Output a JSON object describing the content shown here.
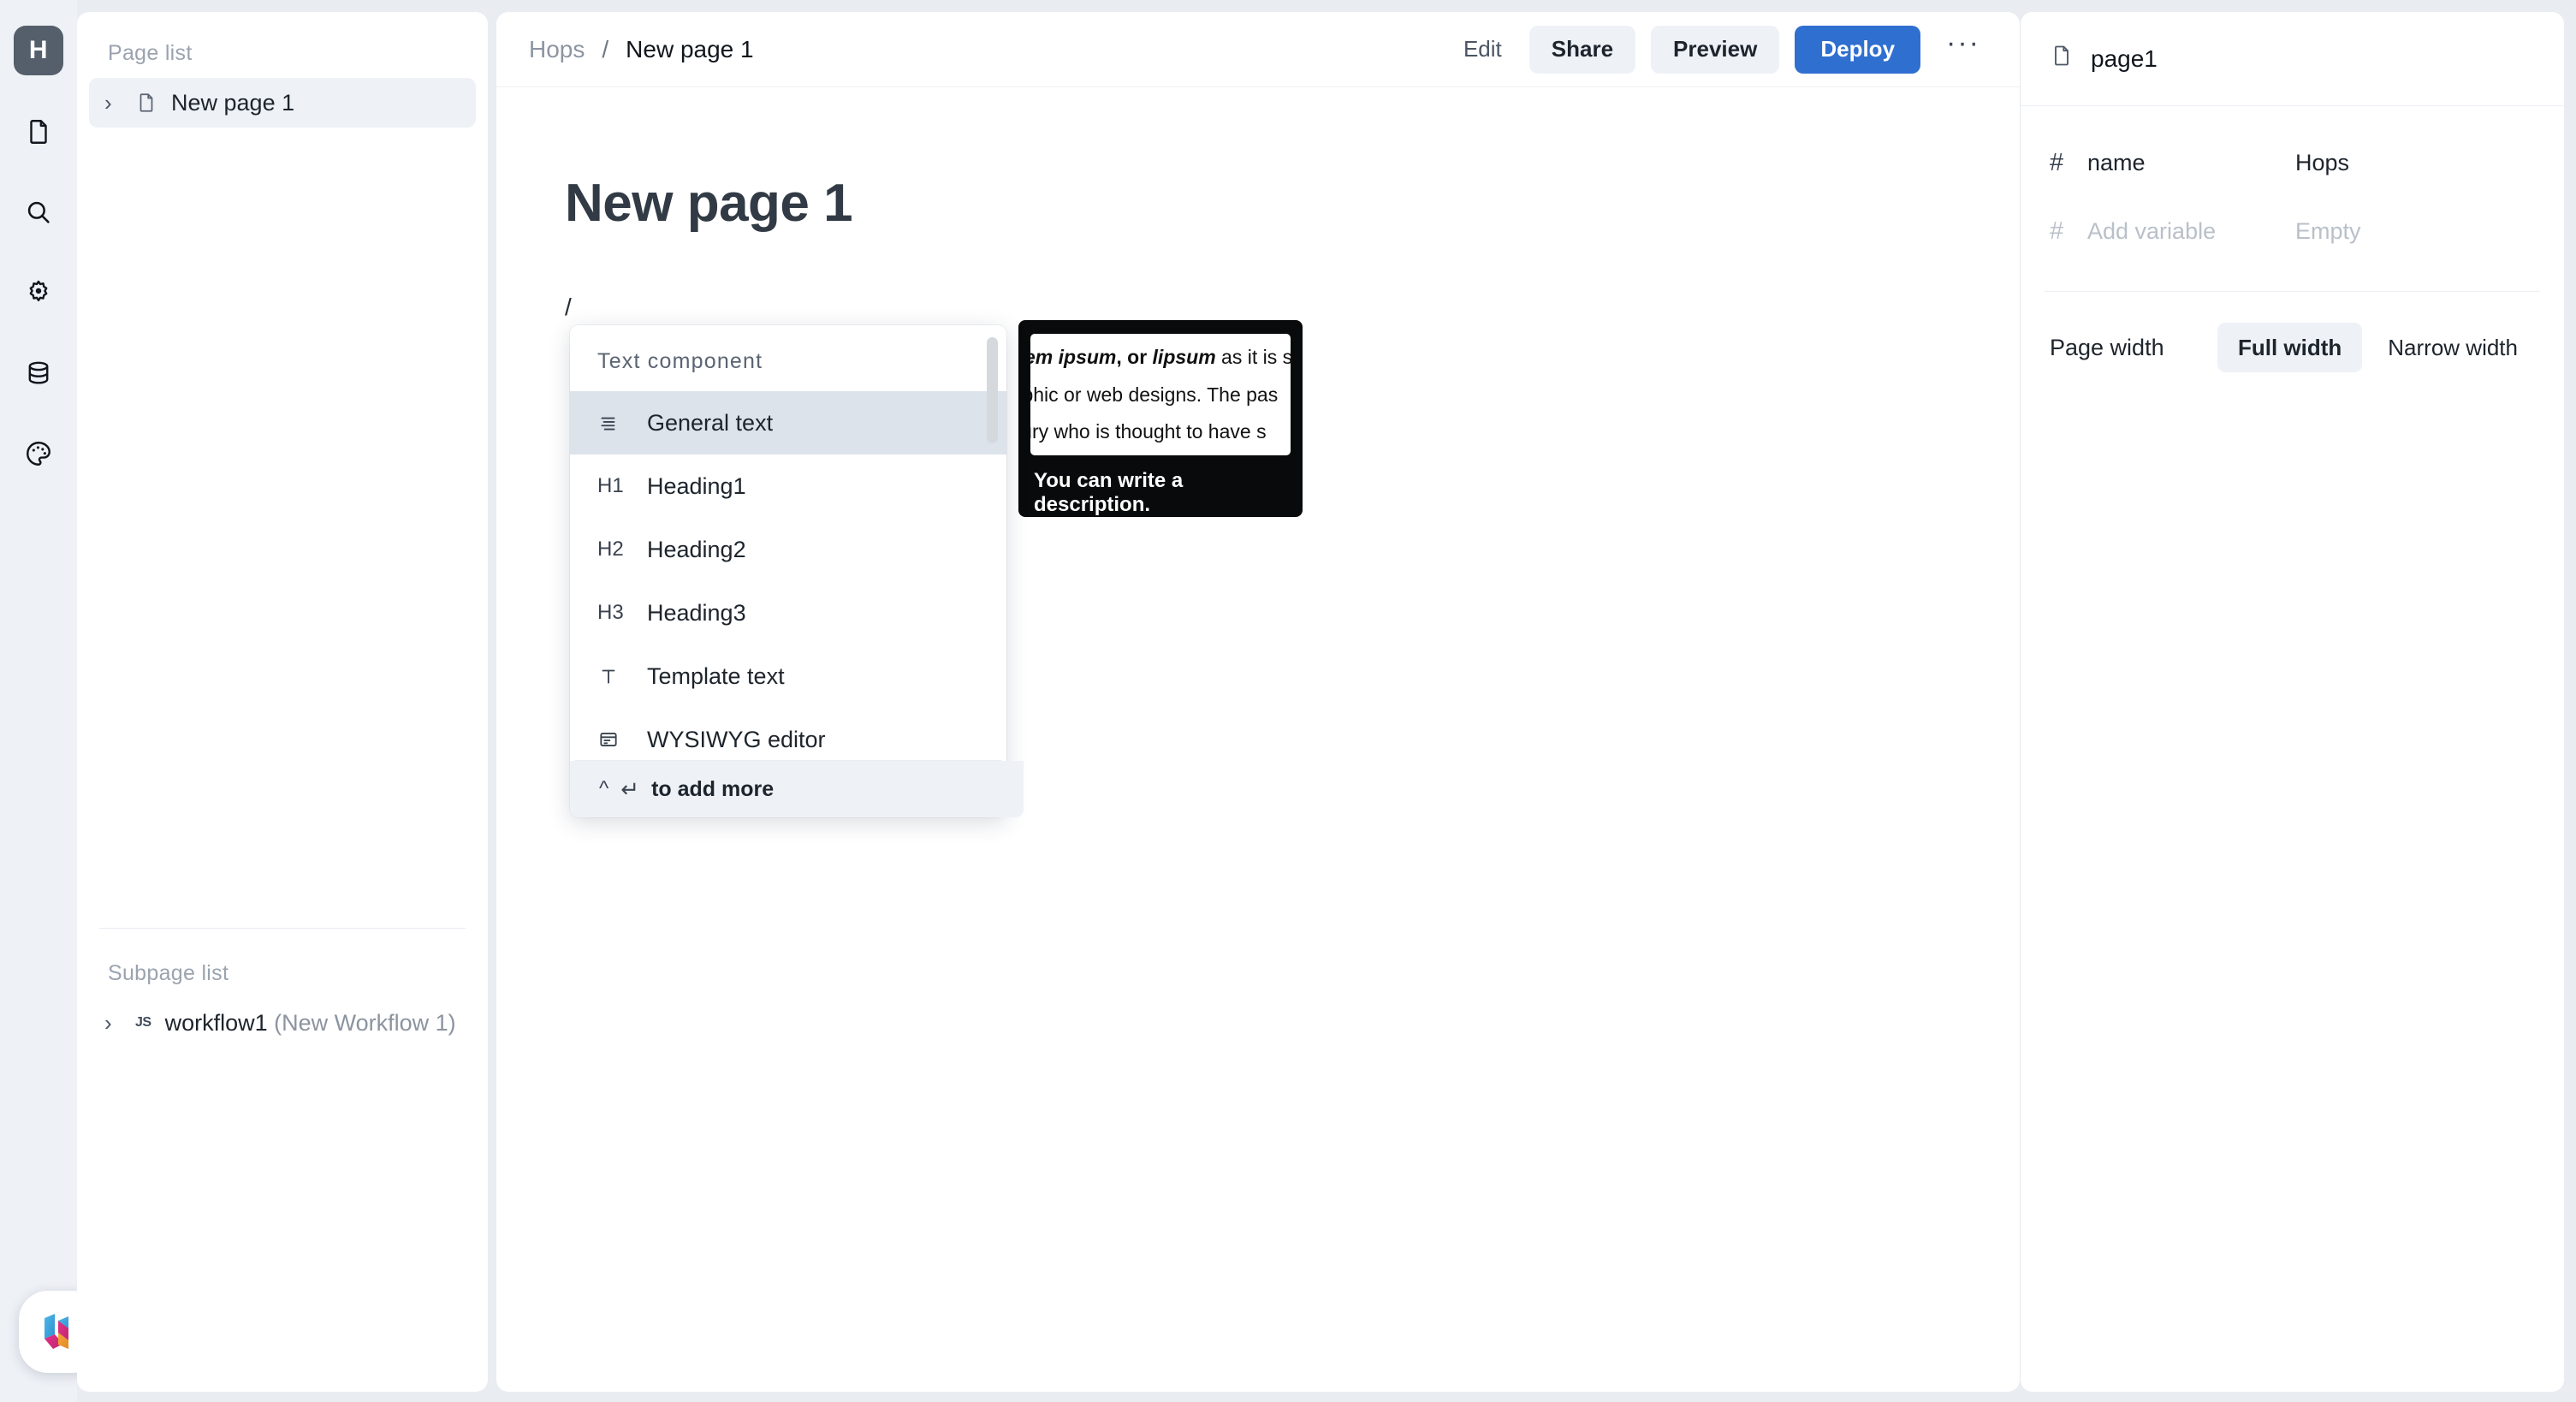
{
  "rail": {
    "logo_label": "H",
    "items": [
      {
        "icon": "page-icon",
        "name": "pages"
      },
      {
        "icon": "search-icon",
        "name": "search"
      },
      {
        "icon": "gear-icon",
        "name": "settings"
      },
      {
        "icon": "database-icon",
        "name": "database"
      },
      {
        "icon": "palette-icon",
        "name": "theme"
      }
    ]
  },
  "sidebar": {
    "page_list_label": "Page list",
    "pages": [
      {
        "label": "New page 1",
        "selected": true
      }
    ],
    "subpage_list_label": "Subpage list",
    "subpages": [
      {
        "icon_label": "JS",
        "label": "workflow1",
        "sublabel": " (New Workflow 1)"
      }
    ]
  },
  "topbar": {
    "breadcrumb_root": "Hops",
    "breadcrumb_sep": "/",
    "breadcrumb_current": "New page 1",
    "edit_label": "Edit",
    "share_label": "Share",
    "preview_label": "Preview",
    "deploy_label": "Deploy",
    "more_label": "···"
  },
  "document": {
    "title": "New page 1",
    "body_text": "/"
  },
  "slash_menu": {
    "header": "Text component",
    "items": [
      {
        "icon": "text-lines-icon",
        "label": "General text",
        "active": true
      },
      {
        "icon": "h1-icon",
        "label": "Heading1",
        "active": false
      },
      {
        "icon": "h2-icon",
        "label": "Heading2",
        "active": false
      },
      {
        "icon": "h3-icon",
        "label": "Heading3",
        "active": false
      },
      {
        "icon": "template-text-icon",
        "label": "Template text",
        "active": false
      },
      {
        "icon": "wysiwyg-icon",
        "label": "WYSIWYG editor",
        "active": false
      }
    ],
    "footer_caret": "^",
    "footer_return": "↵",
    "footer_label": "to add more"
  },
  "tooltip": {
    "lines": [
      "orem ipsum, or lipsum as it is s",
      "raphic or web designs. The pas",
      "ntury who is thought to have s"
    ],
    "caption": "You can write a description."
  },
  "right_panel": {
    "title": "page1",
    "variables": [
      {
        "name": "name",
        "value": "Hops",
        "placeholder": false
      },
      {
        "name": "Add variable",
        "value": "Empty",
        "placeholder": true
      }
    ],
    "page_width_label": "Page width",
    "width_options": [
      {
        "label": "Full width",
        "selected": true
      },
      {
        "label": "Narrow width",
        "selected": false
      }
    ]
  },
  "colors": {
    "accent": "#2f6fd0",
    "page_bg": "#e9edf2",
    "panel_bg": "#ffffff",
    "soft_bg": "#eef1f6",
    "highlight": "#dce3eb",
    "tooltip_bg": "#090a0b"
  }
}
